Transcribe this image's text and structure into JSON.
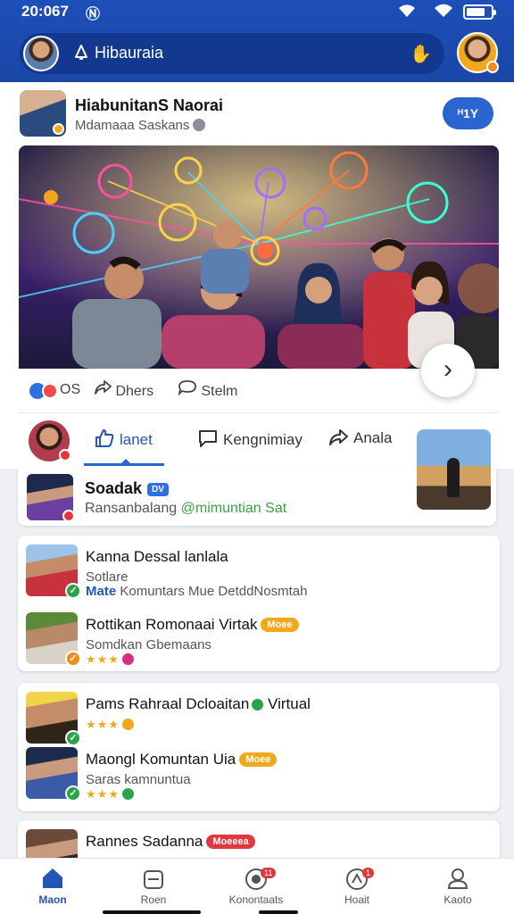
{
  "status": {
    "time": "20:067",
    "nfc_icon": "nfc-icon",
    "wifi_icon": "wifi-icon",
    "battery_icon": "battery-icon"
  },
  "header": {
    "search_text": "Hibauraia",
    "search_icon": "bell-icon",
    "right_icon": "hand-icon",
    "colors": {
      "bar": "#1d4fb8",
      "search": "#12398f"
    }
  },
  "post": {
    "author": "HiabunitanS Naorai",
    "subtitle": "Mdamaaa Saskans",
    "action_button": "ᴴ1Y",
    "reactions_count": "OS",
    "share_label": "Dhers",
    "save_label": "Stelm"
  },
  "actions": {
    "like": "lanet",
    "comment": "Kengnimiay",
    "share": "Anala"
  },
  "entry": {
    "title": "Soadak",
    "tag": "DV",
    "subtitle": "Ransanbalang",
    "mention": "@mimuntian Sat"
  },
  "list_card_1": [
    {
      "title": "Kanna Dessal lanlala",
      "sub": "Sotlare",
      "sub2_prefix": "Mate",
      "sub2": "Komuntars Mue DetddNosmtah"
    },
    {
      "title": "Rottikan Romonaai Virtak",
      "pill": "Moee",
      "sub": "Somdkan Gbemaans"
    }
  ],
  "list_card_2": [
    {
      "title": "Pams Rahraal Dcloaitan",
      "suffix": "Virtual",
      "rating": "★★★"
    },
    {
      "title": "Maongl Komuntan Uia",
      "pill": "Moee",
      "sub": "Saras kamnuntua",
      "rating": "★★★"
    }
  ],
  "list_card_3": [
    {
      "title": "Rannes Sadanna",
      "pill": "Moeeea"
    }
  ],
  "bottom_nav": [
    {
      "label": "Maon",
      "icon": "home-icon"
    },
    {
      "label": "Roen",
      "icon": "bag-icon"
    },
    {
      "label": "Konontaats",
      "icon": "camera-icon",
      "badge": "11"
    },
    {
      "label": "Hoait",
      "icon": "heart-icon",
      "badge": "1"
    },
    {
      "label": "Kaoto",
      "icon": "profile-icon"
    }
  ]
}
